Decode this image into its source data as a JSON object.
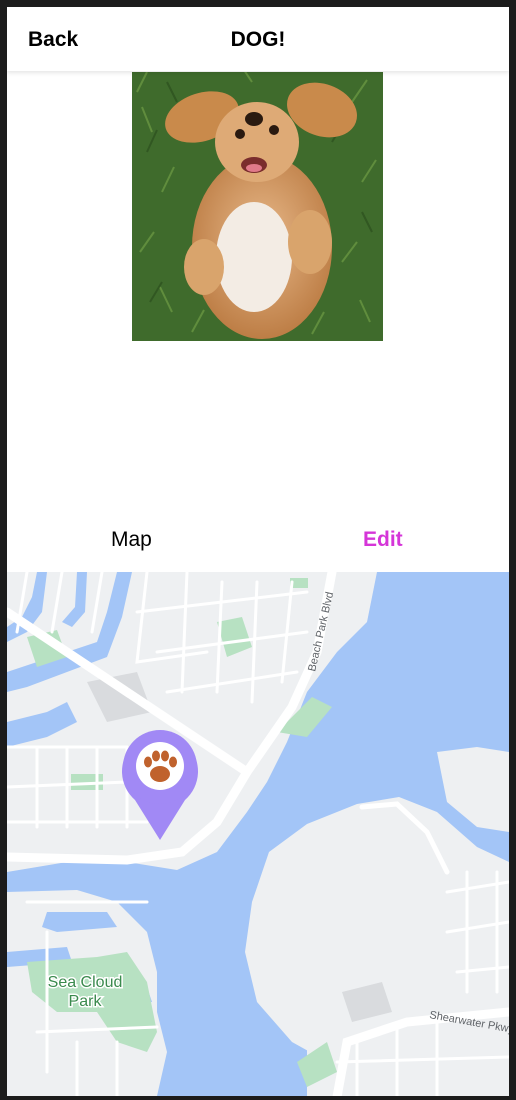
{
  "header": {
    "back_label": "Back",
    "title": "DOG!"
  },
  "tabs": {
    "map_label": "Map",
    "edit_label": "Edit"
  },
  "colors": {
    "accent": "#d535d8",
    "water": "#a3c5f7",
    "park": "#b7e1c2",
    "land": "#eef0f2",
    "pin": "#a189f5",
    "paw": "#c0622d"
  },
  "map": {
    "street_labels": [
      "Beach Park Blvd",
      "Shearwater Pkwy"
    ],
    "park_label_line1": "Sea Cloud",
    "park_label_line2": "Park",
    "marker_icon": "paw-print"
  }
}
